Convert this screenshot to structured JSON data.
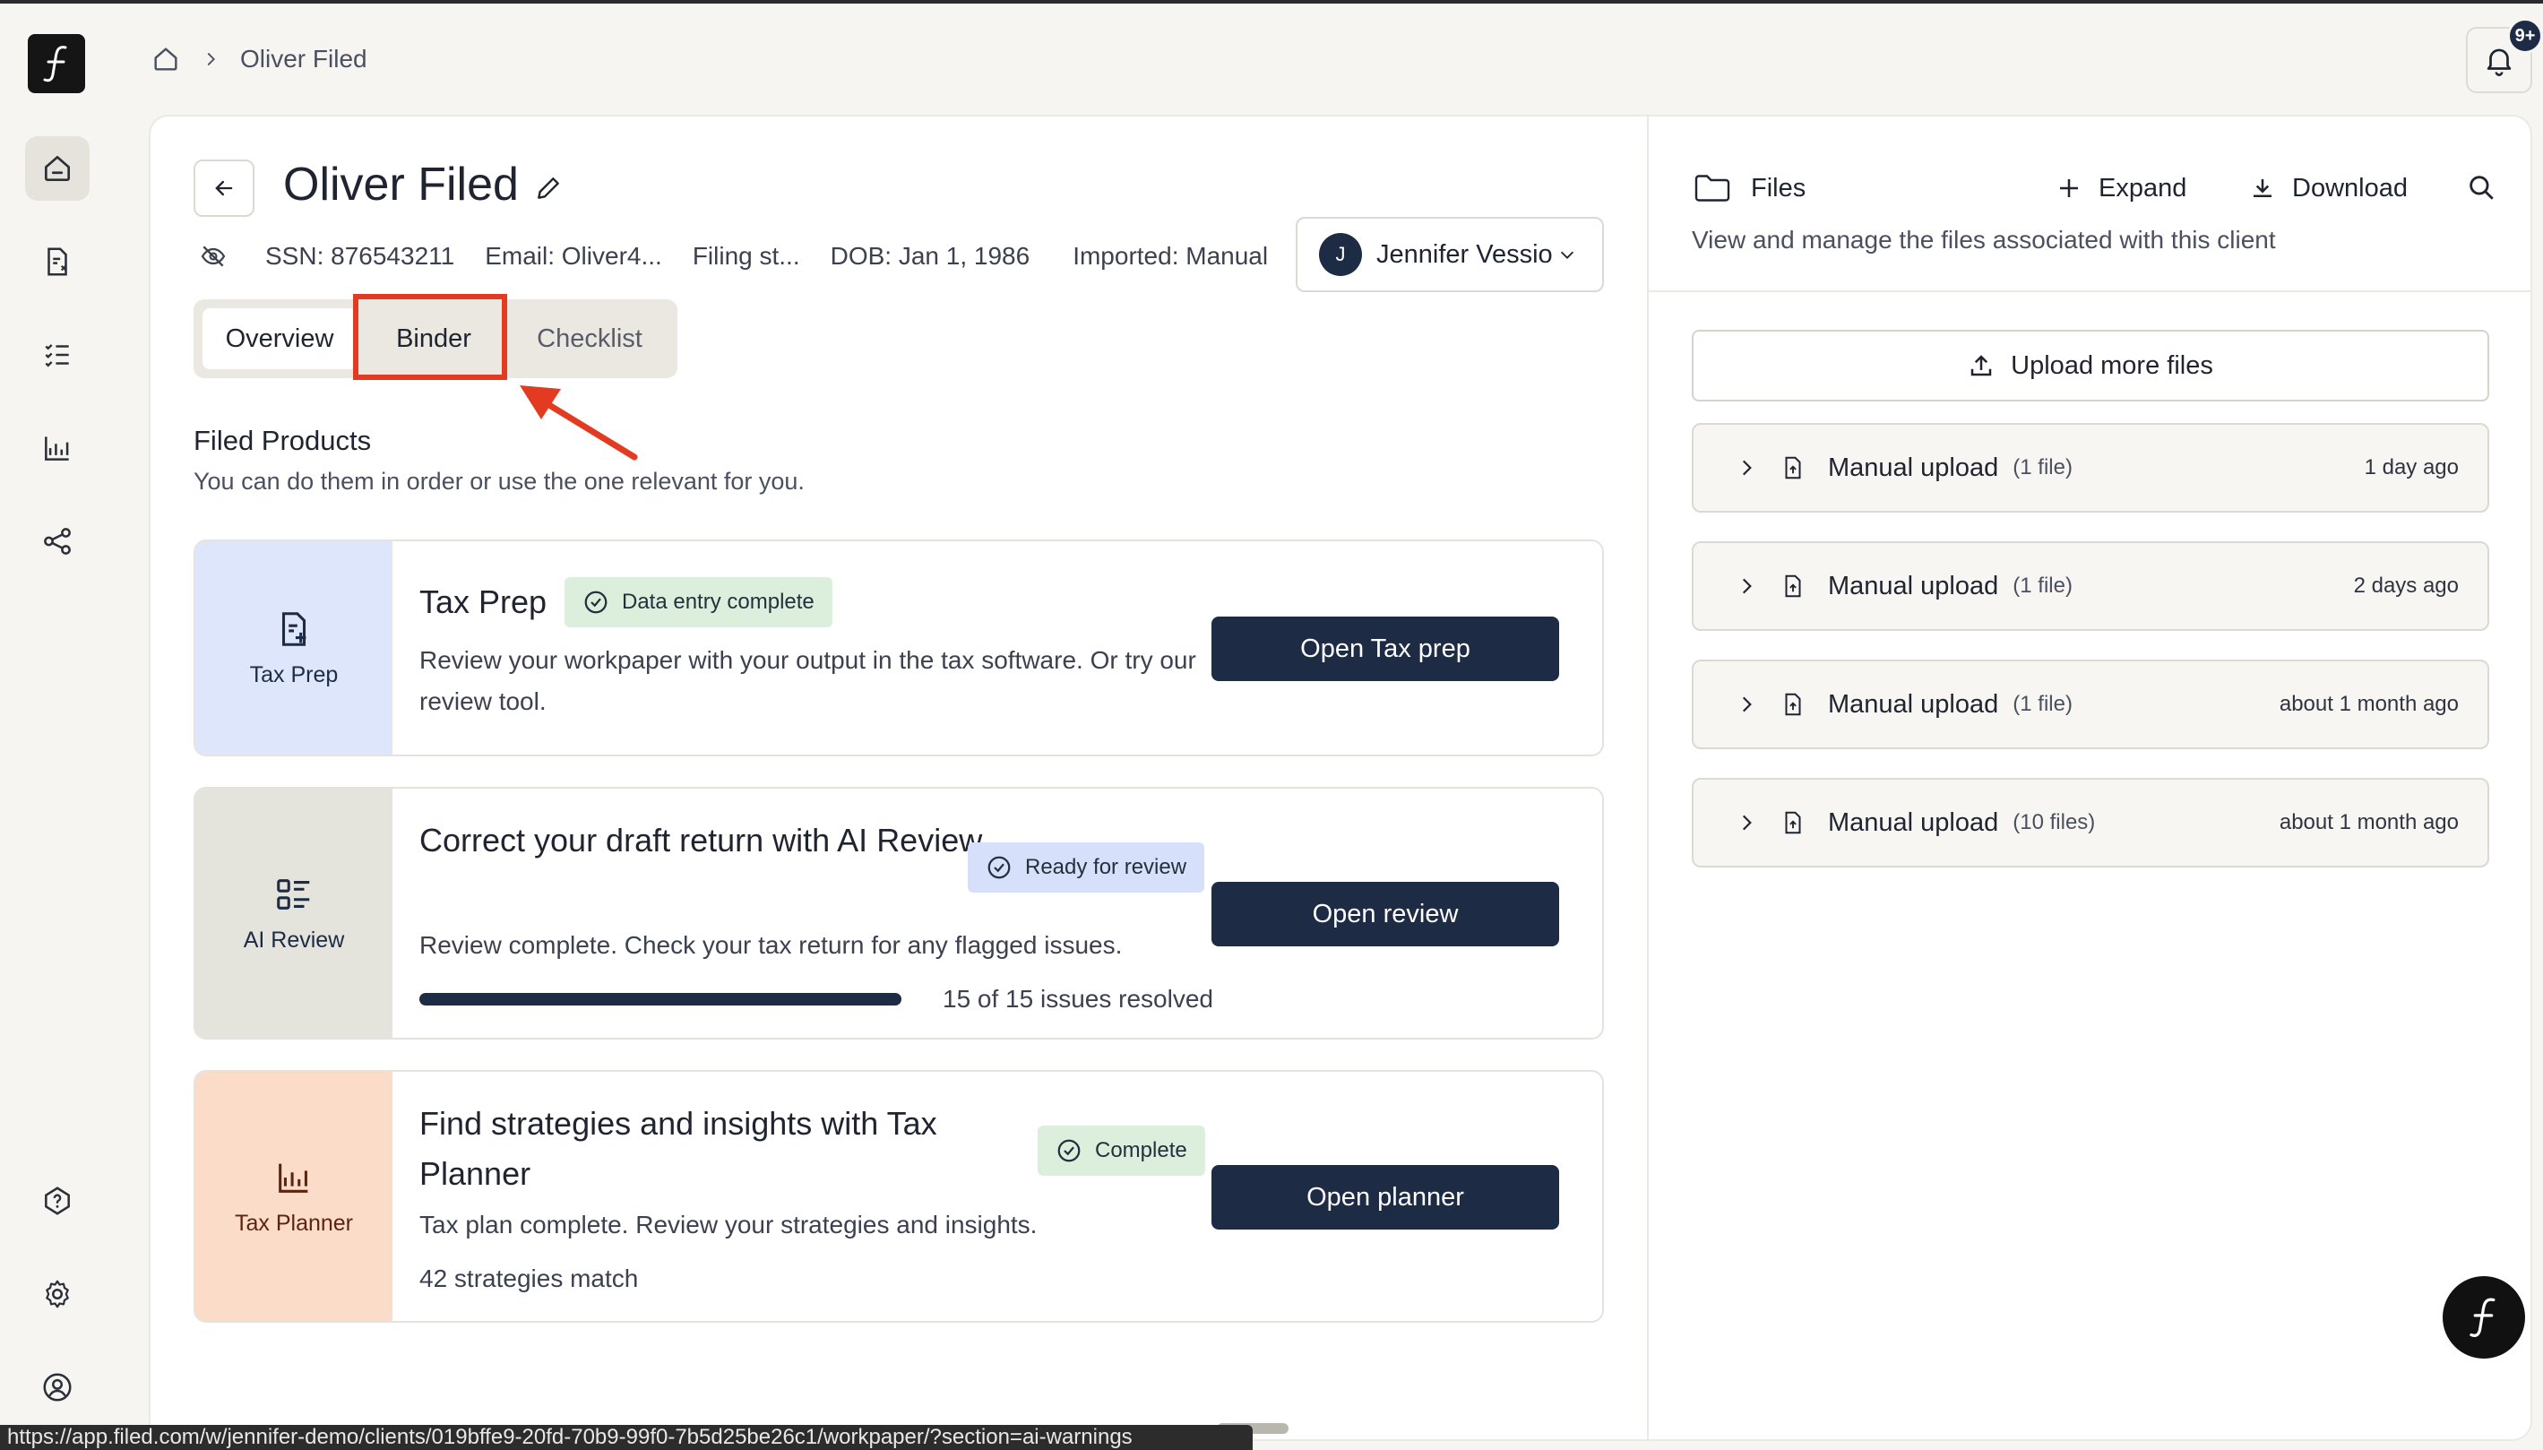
{
  "breadcrumb": {
    "current": "Oliver Filed"
  },
  "notifications": {
    "badge": "9+"
  },
  "client": {
    "name": "Oliver Filed",
    "ssn": "SSN: 876543211",
    "email": "Email: Oliver4...",
    "filing": "Filing st...",
    "dob": "DOB: Jan 1, 1986",
    "imported": "Imported: Manual"
  },
  "assignee": {
    "initial": "J",
    "name": "Jennifer Vessio"
  },
  "tabs": [
    {
      "label": "Overview",
      "selected": true
    },
    {
      "label": "Binder",
      "selected": false
    },
    {
      "label": "Checklist",
      "selected": false
    }
  ],
  "filed_products": {
    "title": "Filed Products",
    "subtitle": "You can do them in order or use the one relevant for you."
  },
  "products": [
    {
      "side_label": "Tax Prep",
      "side_color": "#dde6fb",
      "side_text_color": "#1d2b45",
      "title": "Tax Prep",
      "badge": "Data entry complete",
      "badge_color": "#dcefdc",
      "description": "Review your workpaper with your output in the tax software. Or try our review tool.",
      "button": "Open Tax prep"
    },
    {
      "side_label": "AI Review",
      "side_color": "#e4e4dc",
      "side_text_color": "#1d2b45",
      "title": "Correct your draft return with AI Review",
      "badge": "Ready for review",
      "badge_color": "#d6e0fa",
      "description": "Review complete. Check your tax return for any flagged issues.",
      "progress_fraction": 1.0,
      "progress_text": "15 of 15 issues resolved",
      "button": "Open review"
    },
    {
      "side_label": "Tax Planner",
      "side_color": "#fbdcc9",
      "side_text_color": "#5a2410",
      "title": "Find strategies and insights with Tax Planner",
      "badge": "Complete",
      "badge_color": "#dcefdc",
      "description": "Tax plan complete. Review your strategies and insights.",
      "extra": "42 strategies match",
      "button": "Open planner"
    }
  ],
  "files": {
    "title": "Files",
    "expand": "Expand",
    "download": "Download",
    "subtitle": "View and manage the files associated with this client",
    "upload_label": "Upload more files",
    "rows": [
      {
        "name": "Manual upload",
        "count": "(1 file)",
        "ago": "1 day ago"
      },
      {
        "name": "Manual upload",
        "count": "(1 file)",
        "ago": "2 days ago"
      },
      {
        "name": "Manual upload",
        "count": "(1 file)",
        "ago": "about 1 month ago"
      },
      {
        "name": "Manual upload",
        "count": "(10 files)",
        "ago": "about 1 month ago"
      }
    ]
  },
  "status_url": "https://app.filed.com/w/jennifer-demo/clients/019bffe9-20fd-70b9-99f0-7b5d25be26c1/workpaper/?section=ai-warnings",
  "colors": {
    "navy": "#1d2b45",
    "highlight": "#e23b22",
    "background": "#f6f5f2"
  },
  "icons": {
    "rail": [
      "home-icon",
      "document-icon",
      "checklist-icon",
      "chart-icon",
      "share-icon",
      "help-icon",
      "settings-icon",
      "user-icon"
    ]
  }
}
